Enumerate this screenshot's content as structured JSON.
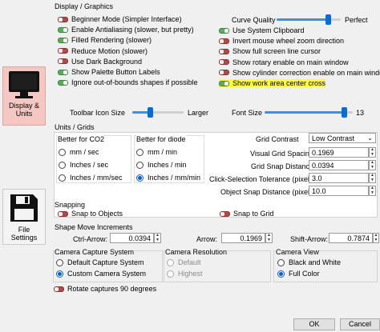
{
  "sidebar": {
    "display_tab": "Display &\nUnits",
    "file_tab": "File\nSettings"
  },
  "display": {
    "title": "Display / Graphics",
    "left_options": [
      {
        "label": "Beginner Mode (Simpler Interface)",
        "on": false
      },
      {
        "label": "Enable Antialiasing (slower, but pretty)",
        "on": true
      },
      {
        "label": "Filled Rendering (slower)",
        "on": true
      },
      {
        "label": "Reduce Motion (slower)",
        "on": false
      },
      {
        "label": "Use Dark Background",
        "on": false
      },
      {
        "label": "Show Palette Button Labels",
        "on": true
      },
      {
        "label": "Ignore out-of-bounds shapes if possible",
        "on": true
      }
    ],
    "curve_quality_label": "Curve Quality",
    "curve_quality_end": "Perfect",
    "curve_quality_value": 0.8,
    "right_options": [
      {
        "label": "Use System Clipboard",
        "on": true
      },
      {
        "label": "Invert mouse wheel zoom direction",
        "on": false
      },
      {
        "label": "Show full screen line cursor",
        "on": false
      },
      {
        "label": "Show rotary enable on main window",
        "on": false
      },
      {
        "label": "Show cylinder correction enable on main window",
        "on": false
      },
      {
        "label": "Show work area center cross",
        "on": true
      }
    ],
    "toolbar_icon_size_label": "Toolbar Icon Size",
    "toolbar_icon_size_end": "Larger",
    "toolbar_icon_size_value": 0.35,
    "font_size_label": "Font Size",
    "font_size_value": "13",
    "font_size_slider": 0.9
  },
  "units": {
    "title": "Units / Grids",
    "co2_group": "Better for CO2",
    "diode_group": "Better for diode",
    "co2_options": [
      "mm / sec",
      "Inches / sec",
      "Inches / mm/sec"
    ],
    "diode_options": [
      "mm / min",
      "Inches / min",
      "Inches / mm/min"
    ],
    "grid_contrast_label": "Grid Contrast",
    "grid_contrast_value": "Low Contrast",
    "visual_spacing_label": "Visual Grid Spacing",
    "visual_spacing_value": "0.1969",
    "snap_distance_label": "Grid Snap Distance",
    "snap_distance_value": "0.0394",
    "click_tolerance_label": "Click-Selection Tolerance (pixels)",
    "click_tolerance_value": "3.0",
    "object_snap_label": "Object Snap Distance (pixels)",
    "object_snap_value": "10.0"
  },
  "snapping": {
    "title": "Snapping",
    "snap_objects": "Snap to Objects",
    "snap_grid": "Snap to Grid"
  },
  "move": {
    "title": "Shape Move Increments",
    "ctrl_label": "Ctrl-Arrow:",
    "ctrl_value": "0.0394",
    "arrow_label": "Arrow:",
    "arrow_value": "0.1969",
    "shift_label": "Shift-Arrow:",
    "shift_value": "0.7874"
  },
  "camera": {
    "capture_title": "Camera Capture System",
    "capture_options": [
      "Default Capture System",
      "Custom Camera System"
    ],
    "resolution_title": "Camera Resolution",
    "resolution_options": [
      "Default",
      "Highest"
    ],
    "view_title": "Camera View",
    "view_options": [
      "Black and White",
      "Full Color"
    ],
    "rotate_label": "Rotate captures 90 degrees"
  },
  "footer": {
    "ok_label": "OK",
    "cancel_label": "Cancel"
  }
}
